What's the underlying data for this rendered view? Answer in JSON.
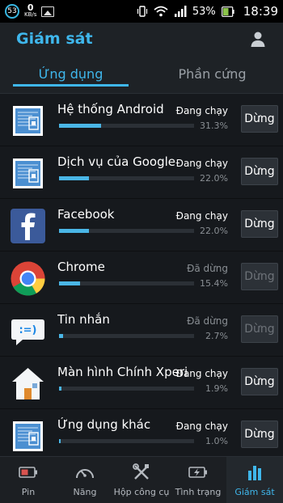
{
  "status_bar": {
    "notif_count": "53",
    "speed_value": "0",
    "speed_unit": "KB/s",
    "battery_pct": "53%",
    "time": "18:39"
  },
  "header": {
    "title": "Giám sát"
  },
  "tabs": [
    {
      "label": "Ứng dụng",
      "active": true
    },
    {
      "label": "Phần cứng",
      "active": false
    }
  ],
  "apps": [
    {
      "name": "Hệ thống Android",
      "status": "Đang chạy",
      "percent": "31.3%",
      "usage": 0.313,
      "button": "Dừng",
      "running": true,
      "icon": "android-system-icon"
    },
    {
      "name": "Dịch vụ của Google",
      "status": "Đang chạy",
      "percent": "22.0%",
      "usage": 0.22,
      "button": "Dừng",
      "running": true,
      "icon": "google-services-icon"
    },
    {
      "name": "Facebook",
      "status": "Đang chạy",
      "percent": "22.0%",
      "usage": 0.22,
      "button": "Dừng",
      "running": true,
      "icon": "facebook-icon"
    },
    {
      "name": "Chrome",
      "status": "Đã dừng",
      "percent": "15.4%",
      "usage": 0.154,
      "button": "Dừng",
      "running": false,
      "icon": "chrome-icon"
    },
    {
      "name": "Tin nhắn",
      "status": "Đã dừng",
      "percent": "2.7%",
      "usage": 0.027,
      "button": "Dừng",
      "running": false,
      "icon": "messages-icon"
    },
    {
      "name": "Màn hình Chính  Xperia",
      "status": "Đang chạy",
      "percent": "1.9%",
      "usage": 0.019,
      "button": "Dừng",
      "running": true,
      "icon": "home-icon"
    },
    {
      "name": "Ứng dụng khác",
      "status": "Đang chạy",
      "percent": "1.0%",
      "usage": 0.01,
      "button": "Dừng",
      "running": true,
      "icon": "other-apps-icon"
    }
  ],
  "bottom_nav": [
    {
      "label": "Pin",
      "icon": "battery-icon",
      "active": false
    },
    {
      "label": "Năng",
      "icon": "speedometer-icon",
      "active": false
    },
    {
      "label": "Hộp công cụ",
      "icon": "tools-icon",
      "active": false
    },
    {
      "label": "Tình trạng",
      "icon": "battery-charging-icon",
      "active": false
    },
    {
      "label": "Giám sát",
      "icon": "bar-chart-icon",
      "active": true
    }
  ],
  "colors": {
    "accent": "#3fb7ec",
    "bar": "#4ab6e6",
    "background": "#16191d"
  }
}
